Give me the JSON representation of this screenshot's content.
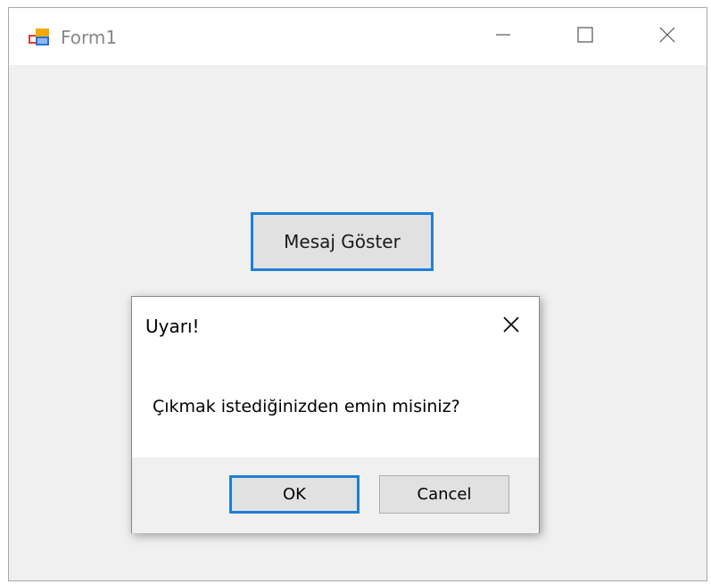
{
  "window": {
    "title": "Form1",
    "icons": {
      "app": "winforms-app-icon",
      "minimize": "minimize-icon",
      "maximize": "maximize-icon",
      "close": "close-icon"
    }
  },
  "form": {
    "button_label": "Mesaj Göster"
  },
  "dialog": {
    "title": "Uyarı!",
    "message": "Çıkmak istediğinizden emin misiniz?",
    "ok_label": "OK",
    "cancel_label": "Cancel",
    "close_icon": "close-icon"
  },
  "colors": {
    "accent": "#1e7fd6",
    "form_background": "#f0f0f0",
    "button_face": "#e1e1e1",
    "titlebar": "#ffffff"
  }
}
